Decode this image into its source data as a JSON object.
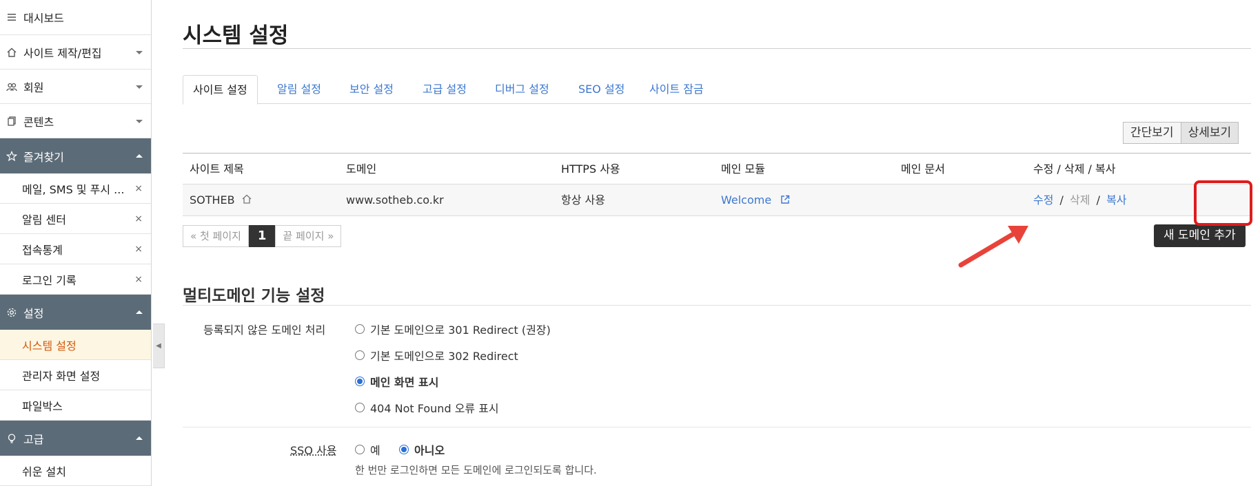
{
  "sidebar": {
    "top_items": [
      {
        "label": "대시보드",
        "icon": "menu-icon"
      },
      {
        "label": "사이트 제작/편집",
        "icon": "home-icon"
      },
      {
        "label": "회원",
        "icon": "users-icon"
      },
      {
        "label": "콘텐츠",
        "icon": "copy-icon"
      }
    ],
    "favorites": {
      "label": "즐겨찾기",
      "items": [
        "메일, SMS 및 푸시 ...",
        "알림 센터",
        "접속통계",
        "로그인 기록"
      ]
    },
    "settings": {
      "label": "설정",
      "items": [
        "시스템 설정",
        "관리자 화면 설정",
        "파일박스"
      ]
    },
    "advanced": {
      "label": "고급",
      "items": [
        "쉬운 설치"
      ]
    },
    "remove_glyph": "×"
  },
  "main": {
    "title": "시스템 설정",
    "tabs": [
      "사이트 설정",
      "알림 설정",
      "보안 설정",
      "고급 설정",
      "디버그 설정",
      "SEO 설정",
      "사이트 잠금"
    ],
    "view_toggle": {
      "simple": "간단보기",
      "detail": "상세보기"
    },
    "table": {
      "headers": [
        "사이트 제목",
        "도메인",
        "HTTPS 사용",
        "메인 모듈",
        "메인 문서",
        "수정 / 삭제 / 복사"
      ],
      "row": {
        "title": "SOTHEB",
        "domain": "www.sotheb.co.kr",
        "https": "항상 사용",
        "module": "Welcome",
        "document": "",
        "edit": "수정",
        "delete": "삭제",
        "copy": "복사",
        "sep": "/"
      }
    },
    "pager": {
      "first": "« 첫 페이지",
      "current": "1",
      "last": "끝 페이지 »"
    },
    "new_domain_button": "새 도메인 추가",
    "multidomain": {
      "section_title": "멀티도메인 기능 설정",
      "unregistered_label": "등록되지 않은 도메인 처리",
      "options": [
        {
          "label": "기본 도메인으로 301 Redirect (권장)",
          "selected": false
        },
        {
          "label": "기본 도메인으로 302 Redirect",
          "selected": false
        },
        {
          "label": "메인 화면 표시",
          "selected": true
        },
        {
          "label": "404 Not Found 오류 표시",
          "selected": false
        }
      ],
      "sso_label": "SSO 사용",
      "sso_options": [
        {
          "label": "예",
          "selected": false
        },
        {
          "label": "아니오",
          "selected": true
        }
      ],
      "sso_help": "한 번만 로그인하면 모든 도메인에 로그인되도록 합니다."
    }
  },
  "colors": {
    "link": "#3b77d0",
    "sidebar_group": "#5c6b78",
    "active_item": "#d4590c",
    "annotation": "#e01b1b"
  }
}
